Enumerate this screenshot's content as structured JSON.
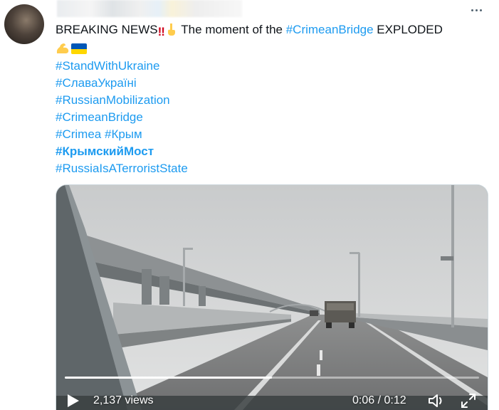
{
  "tweet": {
    "headline": "BREAKING NEWS",
    "headline_mid": "The moment of the",
    "headline_tag": "#CrimeanBridge",
    "headline_end": "EXPLODED",
    "hashtags": {
      "tag1": "#StandWithUkraine",
      "tag2": "#СлаваУкраїні",
      "tag3": "#RussianMobilization",
      "tag4": "#CrimeanBridge",
      "tag5a": "#Crimea",
      "tag5b": "#Крым",
      "tag6": "#КрымскийМост",
      "tag7": "#RussiaIsATerroristState"
    },
    "emoji": {
      "double_exclamation": "‼",
      "pointing_down": "pointing-down-hand-icon",
      "flexed_biceps": "flexed-biceps-icon",
      "ukraine_flag": "ukraine-flag-icon"
    }
  },
  "video": {
    "views": "2,137 views",
    "time": "0:06 / 0:12",
    "progress": 0.5,
    "play_icon": "play-icon",
    "volume_icon": "volume-icon",
    "fullscreen_icon": "fullscreen-icon"
  },
  "colors": {
    "hashtag": "#1d9bf0",
    "text": "#0f1419",
    "flag_blue": "#0057b7",
    "flag_yellow": "#ffd700"
  }
}
